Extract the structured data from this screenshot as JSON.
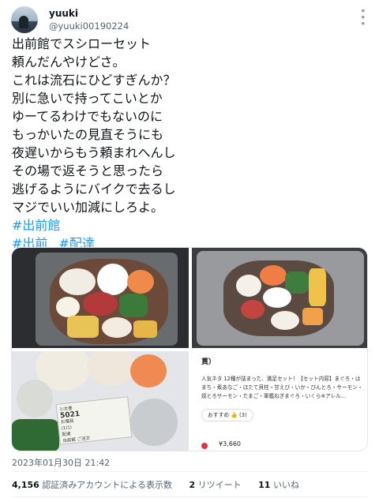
{
  "user": {
    "display_name": "yuuki",
    "handle": "@yuuki00190224"
  },
  "tweet": {
    "lines": [
      "出前館でスシローセット",
      "頼んだんやけどさ。",
      "これは流石にひどすぎんか？",
      "別に急いで持ってこいとか",
      "ゆーてるわけでもないのに",
      "もっかいたの見直そうにも",
      "夜遅いからもう頼まれへんし",
      "その場で返そうと思ったら",
      "逃げるようにバイクで去るし",
      "マジでいい加減にしろよ。"
    ],
    "hashtags_line1": [
      "#出前館"
    ],
    "hashtags_line2": [
      "#出前",
      "#配達"
    ]
  },
  "media": {
    "sticker": {
      "line1": "ｽｼ太巻",
      "line2": "5021",
      "line3": "お電話",
      "line4": "(1/1)",
      "line5": "配達",
      "line6": "出前館 ご注文"
    },
    "ad_card": {
      "title": "貫）",
      "description": "人気ネタ 12種が詰まった、満足セット！【セット内容】まぐろ・はまち・煮あなご・ほたて貝柱・甘えび・いか・びんとろ・サーモン・焼とろサーモン・たまご・軍艦ねぎまぐろ・いくら※アレル…",
      "chip_label": "おすすめ",
      "chip_icon": "thumbs-up",
      "chip_count": "(3)",
      "price": "¥3,660"
    }
  },
  "meta": {
    "timestamp": "2023年01月30日 21:42"
  },
  "stats": {
    "views_count": "4,156",
    "views_label": "認証済みアカウントによる表示数",
    "retweets_count": "2",
    "retweets_label": "リツイート",
    "likes_count": "11",
    "likes_label": "いいね"
  }
}
